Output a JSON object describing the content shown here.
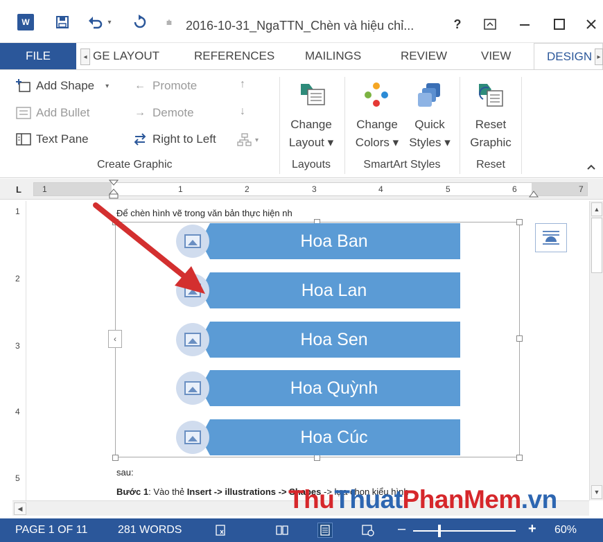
{
  "titlebar": {
    "app_icon": "W",
    "title": "2016-10-31_NgaTTN_Chèn và hiệu chỉ...",
    "help": "?",
    "restore_ribbon": "⊼",
    "minimize": "—",
    "maximize": "☐",
    "close": "✕"
  },
  "tabs": {
    "file": "FILE",
    "page_layout": "GE LAYOUT",
    "references": "REFERENCES",
    "mailings": "MAILINGS",
    "review": "REVIEW",
    "view": "VIEW",
    "design": "DESIGN"
  },
  "ribbon": {
    "create_graphic": {
      "add_shape": "Add Shape",
      "add_bullet": "Add Bullet",
      "text_pane": "Text Pane",
      "promote": "Promote",
      "demote": "Demote",
      "right_to_left": "Right to Left",
      "label": "Create Graphic"
    },
    "layouts": {
      "change_layout_1": "Change",
      "change_layout_2": "Layout ▾",
      "label": "Layouts"
    },
    "smartart_styles": {
      "change_colors_1": "Change",
      "change_colors_2": "Colors ▾",
      "quick_styles_1": "Quick",
      "quick_styles_2": "Styles ▾",
      "label": "SmartArt Styles"
    },
    "reset": {
      "reset_graphic_1": "Reset",
      "reset_graphic_2": "Graphic",
      "label": "Reset"
    }
  },
  "ruler": {
    "corner": "L",
    "numbers": [
      "1",
      "1",
      "2",
      "3",
      "4",
      "5",
      "6",
      "7"
    ]
  },
  "vruler": {
    "numbers": [
      "1",
      "2",
      "3",
      "4",
      "5"
    ]
  },
  "document": {
    "line1": "Để chèn hình vẽ trong văn bản thực hiện nh",
    "line2": "sau:",
    "step1_bold": "Bước 1",
    "step1_rest": ": Vào thẻ ",
    "step1_insert": "Insert -> illustrations -> Shapes",
    "step1_tail": " -> lựa chọn kiểu hình"
  },
  "smartart": {
    "items": [
      "Hoa Ban",
      "Hoa Lan",
      "Hoa Sen",
      "Hoa Quỳnh",
      "Hoa Cúc"
    ],
    "bar_color": "#5b9bd5",
    "circle_color": "#d0dcee"
  },
  "statusbar": {
    "page": "PAGE 1 OF 11",
    "words": "281 WORDS",
    "zoom": "60%",
    "zoom_minus": "–",
    "zoom_plus": "+"
  },
  "watermark": {
    "part1": "Thu",
    "part2": "Thuat",
    "part3": "PhanMem",
    "part4": ".vn"
  },
  "colors": {
    "accent": "#2b579a",
    "arrow": "#d32f2f"
  }
}
